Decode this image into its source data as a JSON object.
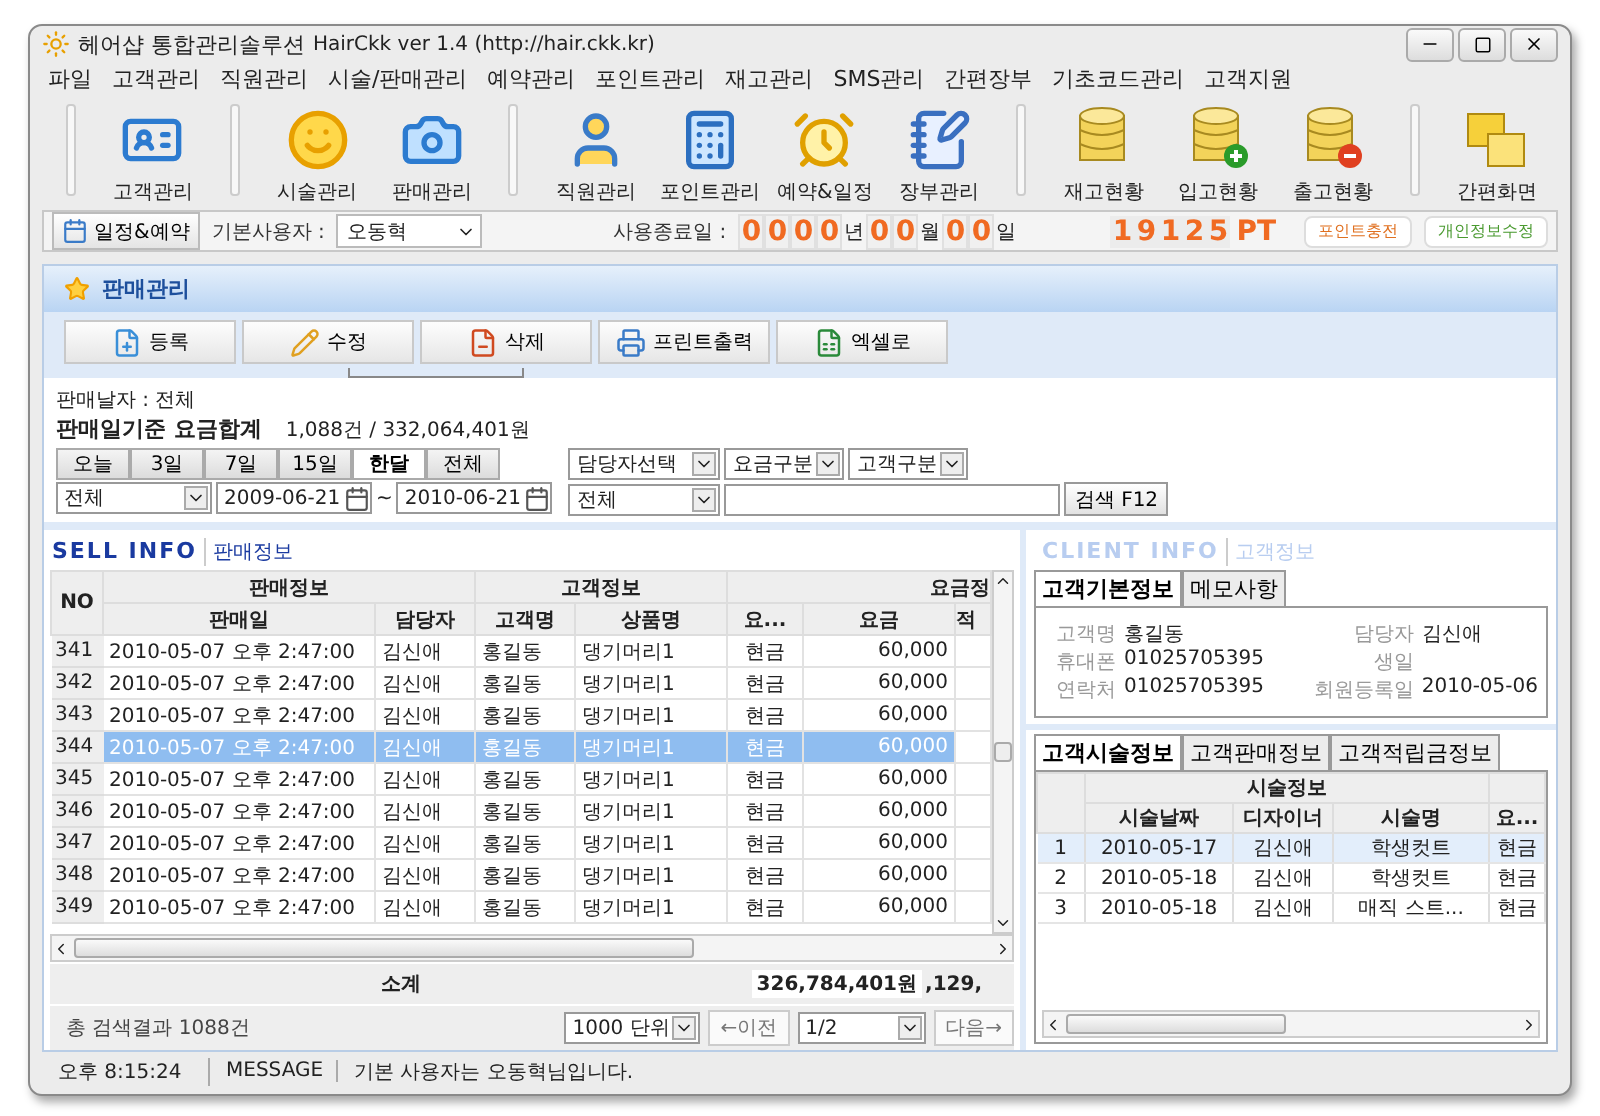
{
  "window": {
    "title": "헤어샵 통합관리솔루션",
    "subtitle": "HairCkk ver 1.4 (http://hair.ckk.kr)"
  },
  "menu": [
    "파일",
    "고객관리",
    "직원관리",
    "시술/판매관리",
    "예약관리",
    "포인트관리",
    "재고관리",
    "SMS관리",
    "간편장부",
    "기초코드관리",
    "고객지원"
  ],
  "toolbar_groups": [
    [
      {
        "label": "고객관리",
        "kind": "card"
      }
    ],
    [
      {
        "label": "시술관리",
        "kind": "smile"
      },
      {
        "label": "판매관리",
        "kind": "camera"
      }
    ],
    [
      {
        "label": "직원관리",
        "kind": "person"
      },
      {
        "label": "포인트관리",
        "kind": "calculator"
      },
      {
        "label": "예약&일정",
        "kind": "alarm"
      },
      {
        "label": "장부관리",
        "kind": "notepad"
      }
    ],
    [
      {
        "label": "재고현황",
        "kind": "database"
      },
      {
        "label": "입고현황",
        "kind": "inbound"
      },
      {
        "label": "출고현황",
        "kind": "outbound"
      }
    ],
    [
      {
        "label": "간편화면",
        "kind": "windows"
      }
    ]
  ],
  "infobar": {
    "schedule_button": "일정&예약",
    "user_label": "기본사용자 :",
    "user": "오동혁",
    "end_label": "사용종료일 :",
    "end_date": [
      {
        "digits": "0000",
        "unit": "년"
      },
      {
        "digits": "00",
        "unit": "월"
      },
      {
        "digits": "00",
        "unit": "일"
      }
    ],
    "points": "19125",
    "points_unit": "PT",
    "charge_button": "포인트충전",
    "profile_button": "개인정보수정"
  },
  "panel": {
    "title": "판매관리",
    "actions": [
      {
        "label": "등록",
        "kind": "add"
      },
      {
        "label": "수정",
        "kind": "edit"
      },
      {
        "label": "삭제",
        "kind": "delete"
      },
      {
        "label": "프린트출력",
        "kind": "print"
      },
      {
        "label": "엑셀로",
        "kind": "excel"
      }
    ]
  },
  "summary": {
    "date_line": "판매날자 : 전체",
    "total_label": "판매일기준 요금합계",
    "total_value": "1,088건 / 332,064,401원"
  },
  "period_tabs": [
    {
      "label": "오늘",
      "selected": false
    },
    {
      "label": "3일",
      "selected": false
    },
    {
      "label": "7일",
      "selected": false
    },
    {
      "label": "15일",
      "selected": false
    },
    {
      "label": "한달",
      "selected": true
    },
    {
      "label": "전체",
      "selected": false
    }
  ],
  "filters": {
    "staff": "담당자선택",
    "fee_type": "요금구분",
    "customer_type": "고객구분",
    "range": "전체",
    "date_from": "2009-06-21",
    "tilde": "~",
    "date_to": "2010-06-21",
    "category": "전체",
    "search_button": "검색 F12"
  },
  "sell": {
    "title": "SELL INFO",
    "subtitle": "판매정보",
    "groups": [
      "판매정보",
      "고객정보",
      "요금정"
    ],
    "columns": [
      "NO",
      "판매일",
      "담당자",
      "고객명",
      "상품명",
      "요...",
      "요금",
      "적"
    ],
    "rows": [
      {
        "cells": [
          "341",
          "2010-05-07 오후 2:47:00",
          "김신애",
          "홍길동",
          "댕기머리1",
          "현금",
          "60,000"
        ],
        "selected": false
      },
      {
        "cells": [
          "342",
          "2010-05-07 오후 2:47:00",
          "김신애",
          "홍길동",
          "댕기머리1",
          "현금",
          "60,000"
        ],
        "selected": false
      },
      {
        "cells": [
          "343",
          "2010-05-07 오후 2:47:00",
          "김신애",
          "홍길동",
          "댕기머리1",
          "현금",
          "60,000"
        ],
        "selected": false
      },
      {
        "cells": [
          "344",
          "2010-05-07 오후 2:47:00",
          "김신애",
          "홍길동",
          "댕기머리1",
          "현금",
          "60,000"
        ],
        "selected": true
      },
      {
        "cells": [
          "345",
          "2010-05-07 오후 2:47:00",
          "김신애",
          "홍길동",
          "댕기머리1",
          "현금",
          "60,000"
        ],
        "selected": false
      },
      {
        "cells": [
          "346",
          "2010-05-07 오후 2:47:00",
          "김신애",
          "홍길동",
          "댕기머리1",
          "현금",
          "60,000"
        ],
        "selected": false
      },
      {
        "cells": [
          "347",
          "2010-05-07 오후 2:47:00",
          "김신애",
          "홍길동",
          "댕기머리1",
          "현금",
          "60,000"
        ],
        "selected": false
      },
      {
        "cells": [
          "348",
          "2010-05-07 오후 2:47:00",
          "김신애",
          "홍길동",
          "댕기머리1",
          "현금",
          "60,000"
        ],
        "selected": false
      },
      {
        "cells": [
          "349",
          "2010-05-07 오후 2:47:00",
          "김신애",
          "홍길동",
          "댕기머리1",
          "현금",
          "60,000"
        ],
        "selected": false
      }
    ],
    "subtotal": {
      "label": "소계",
      "value": "326,784,401원",
      "value_2": ",129,"
    },
    "footer": {
      "result": "총 검색결과 1088건",
      "page_size": "1000 단위",
      "prev": "←이전",
      "page": "1/2",
      "next": "다음→"
    }
  },
  "client": {
    "title": "CLIENT INFO",
    "subtitle": "고객정보",
    "tabs": [
      {
        "label": "고객기본정보",
        "selected": true
      },
      {
        "label": "메모사항",
        "selected": false
      }
    ],
    "fields": [
      {
        "label": "고객명",
        "value": "홍길동"
      },
      {
        "label": "담당자",
        "value": "김신애"
      },
      {
        "label": "휴대폰",
        "value": "01025705395"
      },
      {
        "label": "생일"
      },
      {
        "label": "연락처",
        "value": "01025705395"
      },
      {
        "label": "회원등록일",
        "value": "2010-05-06"
      }
    ],
    "history_tabs": [
      {
        "label": "고객시술정보",
        "selected": true
      },
      {
        "label": "고객판매정보",
        "selected": false
      },
      {
        "label": "고객적립금정보",
        "selected": false
      }
    ],
    "history": {
      "group": "시술정보",
      "columns": [
        "시술날짜",
        "디자이너",
        "시술명",
        "요..."
      ],
      "rows": [
        {
          "no": "1",
          "cells": [
            "2010-05-17",
            "김신애",
            "학생컷트",
            "현금"
          ],
          "selected": true
        },
        {
          "no": "2",
          "cells": [
            "2010-05-18",
            "김신애",
            "학생컷트",
            "현금"
          ],
          "selected": false
        },
        {
          "no": "3",
          "cells": [
            "2010-05-18",
            "김신애",
            "매직 스트...",
            "현금"
          ],
          "selected": false
        }
      ]
    }
  },
  "status_bar": {
    "time": "오후 8:15:24",
    "message_label": "MESSAGE",
    "message": "기본 사용자는 오동혁님입니다."
  }
}
